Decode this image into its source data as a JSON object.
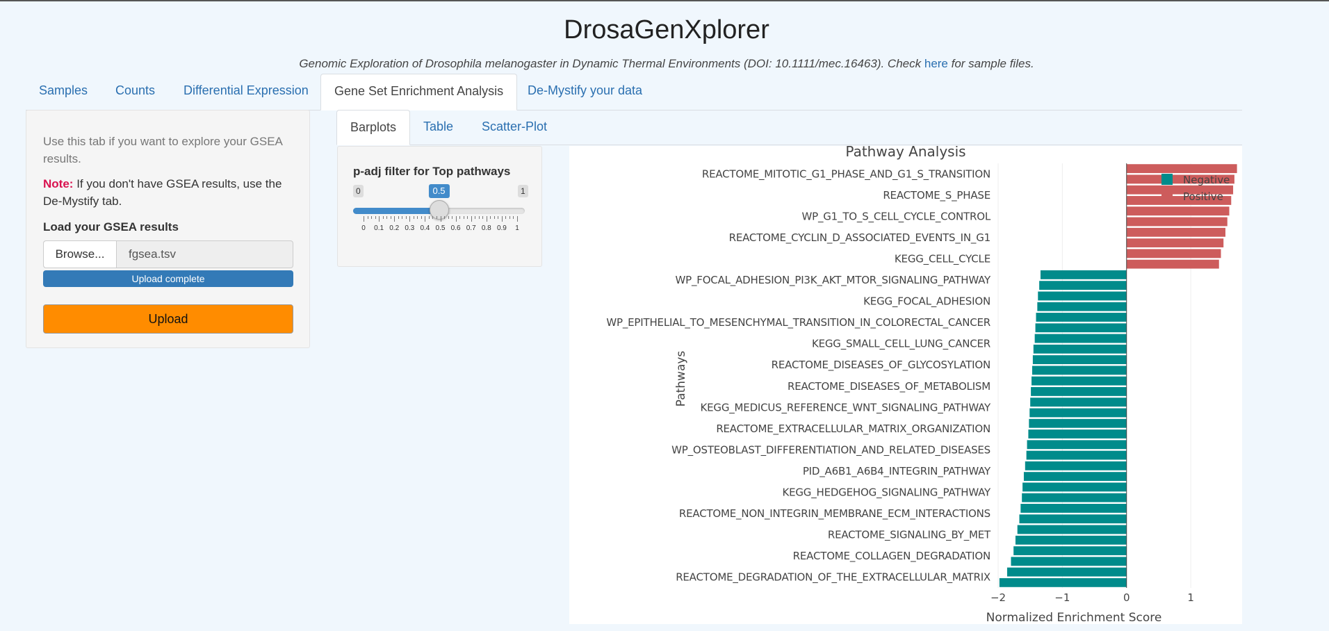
{
  "app": {
    "title": "DrosaGenXplorer",
    "subtitle_prefix": "Genomic Exploration of Drosophila melanogaster in Dynamic Thermal Environments (DOI: 10.1111/mec.16463). Check",
    "subtitle_link": "here",
    "subtitle_suffix": "for sample files."
  },
  "main_tabs": [
    {
      "label": "Samples"
    },
    {
      "label": "Counts"
    },
    {
      "label": "Differential Expression"
    },
    {
      "label": "Gene Set Enrichment Analysis",
      "active": true
    },
    {
      "label": "De-Mystify your data"
    }
  ],
  "sidebar": {
    "help_text": "Use this tab if you want to explore your GSEA results.",
    "note_label": "Note:",
    "note_text": "If you don't have GSEA results, use the De-Mystify tab.",
    "load_label": "Load your GSEA results",
    "browse_label": "Browse...",
    "file_name": "fgsea.tsv",
    "progress_text": "Upload complete",
    "upload_label": "Upload"
  },
  "sub_tabs": [
    {
      "label": "Barplots",
      "active": true
    },
    {
      "label": "Table"
    },
    {
      "label": "Scatter-Plot"
    }
  ],
  "filter": {
    "label": "p-adj filter for Top pathways",
    "min": "0",
    "max": "1",
    "value": "0.5",
    "value_fraction": 0.5,
    "ticks": [
      "0",
      "0.1",
      "0.2",
      "0.3",
      "0.4",
      "0.5",
      "0.6",
      "0.7",
      "0.8",
      "0.9",
      "1"
    ]
  },
  "chart_data": {
    "type": "bar",
    "orientation": "horizontal",
    "title": "Pathway Analysis",
    "xlabel": "Normalized Enrichment Score",
    "ylabel": "Pathways",
    "xlim": [
      -2,
      1.8
    ],
    "xticks": [
      "−2",
      "−1",
      "0",
      "1"
    ],
    "xtick_values": [
      -2,
      -1,
      0,
      1
    ],
    "grid": true,
    "legend_position": "top-right",
    "colors": {
      "Negative": "#008b8b",
      "Positive": "#cd5c5c"
    },
    "categories": [
      "REACTOME_MITOTIC_G1_PHASE_AND_G1_S_TRANSITION",
      "REACTOME_S_PHASE",
      "WP_G1_TO_S_CELL_CYCLE_CONTROL",
      "REACTOME_CYCLIN_D_ASSOCIATED_EVENTS_IN_G1",
      "KEGG_CELL_CYCLE",
      "WP_FOCAL_ADHESION_PI3K_AKT_MTOR_SIGNALING_PATHWAY",
      "KEGG_FOCAL_ADHESION",
      "WP_EPITHELIAL_TO_MESENCHYMAL_TRANSITION_IN_COLORECTAL_CANCER",
      "KEGG_SMALL_CELL_LUNG_CANCER",
      "REACTOME_DISEASES_OF_GLYCOSYLATION",
      "REACTOME_DISEASES_OF_METABOLISM",
      "KEGG_MEDICUS_REFERENCE_WNT_SIGNALING_PATHWAY",
      "REACTOME_EXTRACELLULAR_MATRIX_ORGANIZATION",
      "WP_OSTEOBLAST_DIFFERENTIATION_AND_RELATED_DISEASES",
      "PID_A6B1_A6B4_INTEGRIN_PATHWAY",
      "KEGG_HEDGEHOG_SIGNALING_PATHWAY",
      "REACTOME_NON_INTEGRIN_MEMBRANE_ECM_INTERACTIONS",
      "REACTOME_SIGNALING_BY_MET",
      "REACTOME_COLLAGEN_DEGRADATION",
      "REACTOME_DEGRADATION_OF_THE_EXTRACELLULAR_MATRIX"
    ],
    "series": [
      {
        "name": "Positive",
        "pairs": [
          [
            "REACTOME_MITOTIC_G1_PHASE_AND_G1_S_TRANSITION",
            1.72,
            0.5
          ],
          [
            "REACTOME_MITOTIC_G1_PHASE_AND_G1_S_TRANSITION",
            1.68,
            1.0
          ],
          [
            "REACTOME_S_PHASE",
            1.66,
            1.5
          ],
          [
            "REACTOME_S_PHASE",
            1.63,
            2.0
          ],
          [
            "WP_G1_TO_S_CELL_CYCLE_CONTROL",
            1.6,
            2.5
          ],
          [
            "WP_G1_TO_S_CELL_CYCLE_CONTROL",
            1.57,
            3.0
          ],
          [
            "REACTOME_CYCLIN_D_ASSOCIATED_EVENTS_IN_G1",
            1.54,
            3.5
          ],
          [
            "REACTOME_CYCLIN_D_ASSOCIATED_EVENTS_IN_G1",
            1.51,
            4.0
          ],
          [
            "KEGG_CELL_CYCLE",
            1.47,
            4.5
          ],
          [
            "KEGG_CELL_CYCLE",
            1.44,
            5.0
          ]
        ]
      },
      {
        "name": "Negative",
        "pairs": [
          [
            "WP_FOCAL_ADHESION_PI3K_AKT_MTOR_SIGNALING_PATHWAY",
            -1.34,
            5.5
          ],
          [
            "WP_FOCAL_ADHESION_PI3K_AKT_MTOR_SIGNALING_PATHWAY",
            -1.36,
            6.0
          ],
          [
            "KEGG_FOCAL_ADHESION",
            -1.38,
            6.5
          ],
          [
            "KEGG_FOCAL_ADHESION",
            -1.39,
            7.0
          ],
          [
            "WP_EPITHELIAL_TO_MESENCHYMAL_TRANSITION_IN_COLORECTAL_CANCER",
            -1.41,
            7.5
          ],
          [
            "WP_EPITHELIAL_TO_MESENCHYMAL_TRANSITION_IN_COLORECTAL_CANCER",
            -1.42,
            8.0
          ],
          [
            "KEGG_SMALL_CELL_LUNG_CANCER",
            -1.43,
            8.5
          ],
          [
            "KEGG_SMALL_CELL_LUNG_CANCER",
            -1.45,
            9.0
          ],
          [
            "REACTOME_DISEASES_OF_GLYCOSYLATION",
            -1.46,
            9.5
          ],
          [
            "REACTOME_DISEASES_OF_GLYCOSYLATION",
            -1.47,
            10.0
          ],
          [
            "REACTOME_DISEASES_OF_METABOLISM",
            -1.48,
            10.5
          ],
          [
            "REACTOME_DISEASES_OF_METABOLISM",
            -1.49,
            11.0
          ],
          [
            "KEGG_MEDICUS_REFERENCE_WNT_SIGNALING_PATHWAY",
            -1.5,
            11.5
          ],
          [
            "KEGG_MEDICUS_REFERENCE_WNT_SIGNALING_PATHWAY",
            -1.51,
            12.0
          ],
          [
            "REACTOME_EXTRACELLULAR_MATRIX_ORGANIZATION",
            -1.52,
            12.5
          ],
          [
            "REACTOME_EXTRACELLULAR_MATRIX_ORGANIZATION",
            -1.53,
            13.0
          ],
          [
            "WP_OSTEOBLAST_DIFFERENTIATION_AND_RELATED_DISEASES",
            -1.55,
            13.5
          ],
          [
            "WP_OSTEOBLAST_DIFFERENTIATION_AND_RELATED_DISEASES",
            -1.56,
            14.0
          ],
          [
            "PID_A6B1_A6B4_INTEGRIN_PATHWAY",
            -1.58,
            14.5
          ],
          [
            "PID_A6B1_A6B4_INTEGRIN_PATHWAY",
            -1.6,
            15.0
          ],
          [
            "KEGG_HEDGEHOG_SIGNALING_PATHWAY",
            -1.62,
            15.5
          ],
          [
            "KEGG_HEDGEHOG_SIGNALING_PATHWAY",
            -1.63,
            16.0
          ],
          [
            "REACTOME_NON_INTEGRIN_MEMBRANE_ECM_INTERACTIONS",
            -1.65,
            16.5
          ],
          [
            "REACTOME_NON_INTEGRIN_MEMBRANE_ECM_INTERACTIONS",
            -1.67,
            17.0
          ],
          [
            "REACTOME_SIGNALING_BY_MET",
            -1.7,
            17.5
          ],
          [
            "REACTOME_SIGNALING_BY_MET",
            -1.73,
            18.0
          ],
          [
            "REACTOME_COLLAGEN_DEGRADATION",
            -1.76,
            18.5
          ],
          [
            "REACTOME_COLLAGEN_DEGRADATION",
            -1.8,
            19.0
          ],
          [
            "REACTOME_DEGRADATION_OF_THE_EXTRACELLULAR_MATRIX",
            -1.86,
            19.5
          ],
          [
            "REACTOME_DEGRADATION_OF_THE_EXTRACELLULAR_MATRIX",
            -1.98,
            20.0
          ]
        ]
      }
    ]
  }
}
